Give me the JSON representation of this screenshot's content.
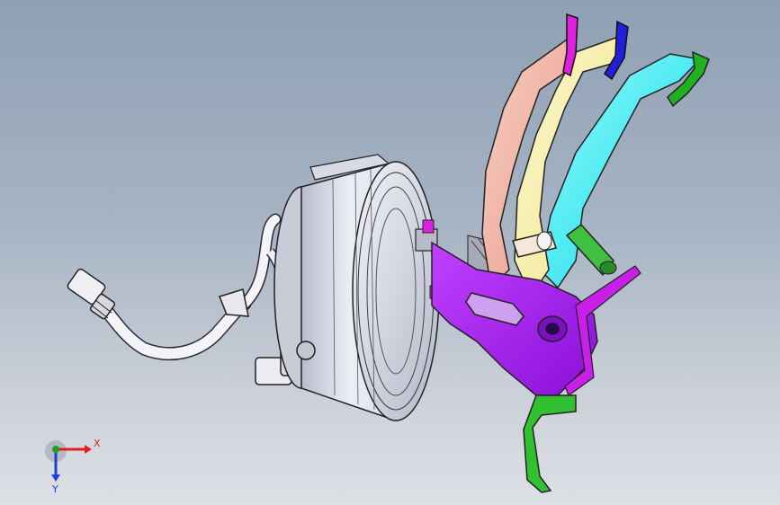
{
  "viewport": {
    "name": "3D model view",
    "background_top": "#8fa0b4",
    "background_bottom": "#dde0e5"
  },
  "model": {
    "parts": [
      {
        "name": "vacuum-booster",
        "color": "#e4e6f0"
      },
      {
        "name": "vacuum-hose",
        "color": "#f4f4f8"
      },
      {
        "name": "mounting-bracket",
        "color": "#a020f0"
      },
      {
        "name": "pedal-salmon",
        "color": "#f4b8a8"
      },
      {
        "name": "pedal-yellow",
        "color": "#f8f0a8"
      },
      {
        "name": "pedal-cyan",
        "color": "#38f0f0"
      },
      {
        "name": "pedal-pad-magenta",
        "color": "#e020e0"
      },
      {
        "name": "pedal-pad-blue",
        "color": "#2020d8"
      },
      {
        "name": "pedal-pad-green",
        "color": "#20b020"
      },
      {
        "name": "lower-arm-green",
        "color": "#30c030"
      }
    ]
  },
  "triad": {
    "x_label": "X",
    "y_label": "Y",
    "x_color": "#e02020",
    "y_color": "#20a020",
    "z_color": "#2040d0"
  }
}
